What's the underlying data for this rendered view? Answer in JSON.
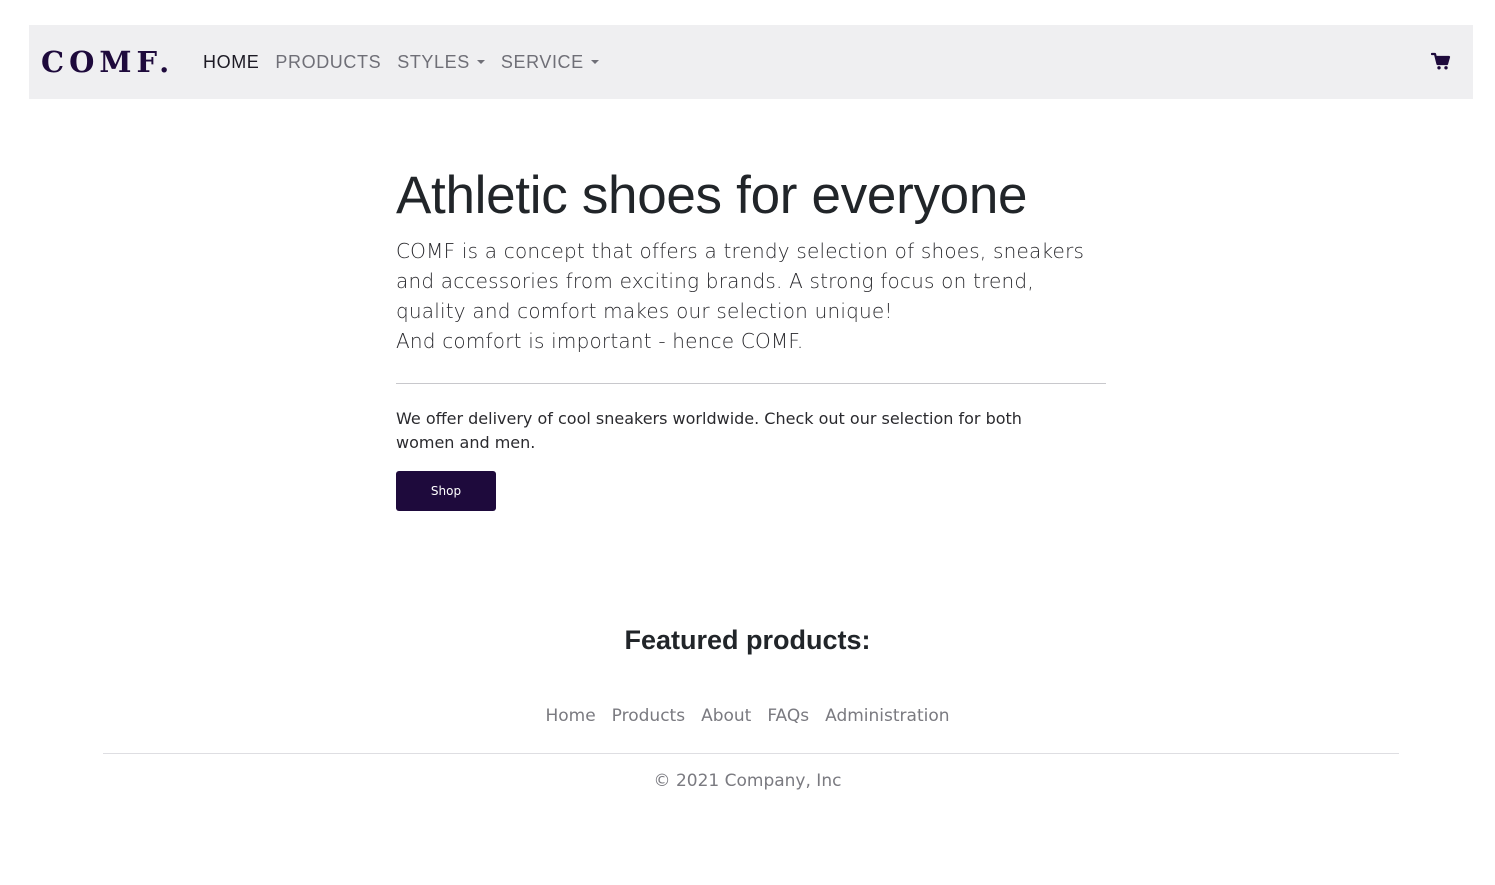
{
  "navbar": {
    "brand": "COMF.",
    "links": [
      {
        "label": "HOME",
        "active": true,
        "dropdown": false
      },
      {
        "label": "PRODUCTS",
        "active": false,
        "dropdown": false
      },
      {
        "label": "STYLES",
        "active": false,
        "dropdown": true
      },
      {
        "label": "SERVICE",
        "active": false,
        "dropdown": true
      }
    ],
    "cart_icon": "shopping-cart-icon"
  },
  "hero": {
    "title": "Athletic shoes for everyone",
    "lead_lines": [
      "COMF is a concept that offers a trendy selection of shoes, sneakers",
      "and accessories from exciting brands. A strong focus on trend,",
      "quality and comfort makes our selection unique!",
      "And comfort is important - hence COMF."
    ],
    "sub": "We offer delivery of cool sneakers worldwide. Check out our selection for both women and men.",
    "button_label": "Shop"
  },
  "featured": {
    "title": "Featured products:"
  },
  "footer": {
    "links": [
      "Home",
      "Products",
      "About",
      "FAQs",
      "Administration"
    ],
    "copyright": "© 2021 Company, Inc"
  },
  "colors": {
    "brand": "#1e0a3c",
    "navbar_bg": "#efeff1",
    "muted_text": "#7a7a80"
  }
}
